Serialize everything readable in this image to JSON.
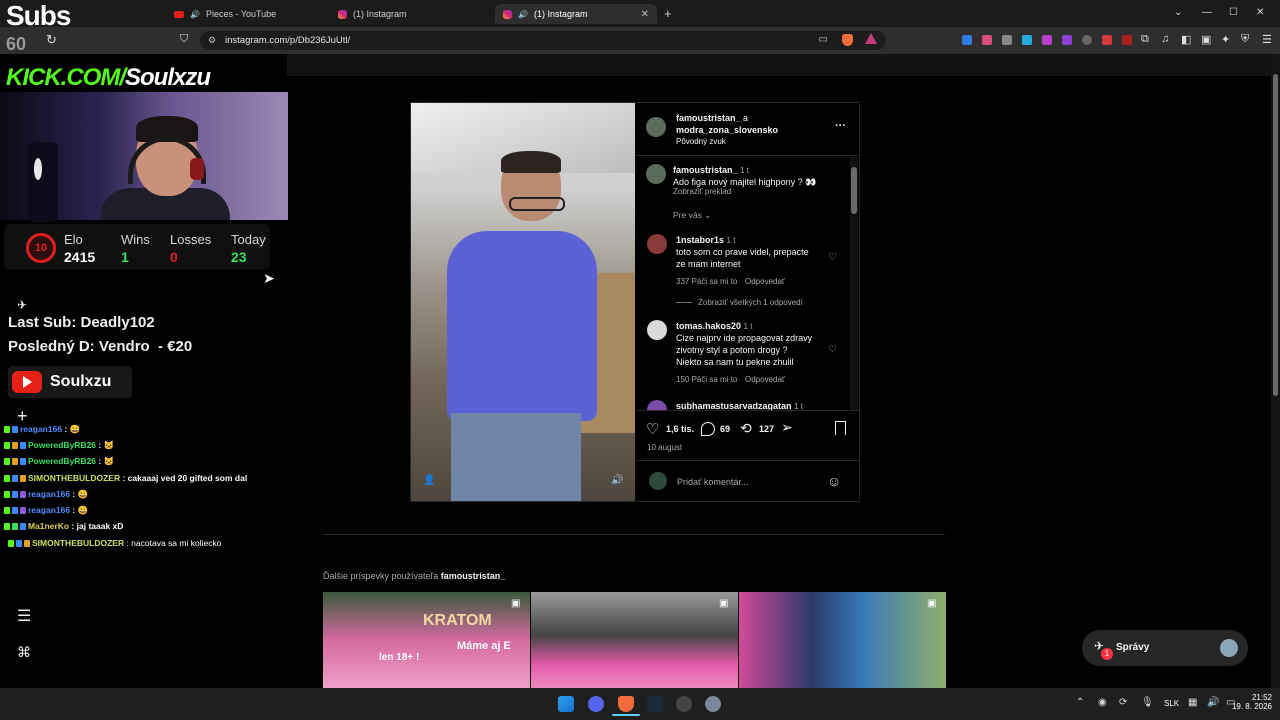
{
  "browser": {
    "tabs": [
      {
        "label": "Pieces - YouTube",
        "type": "youtube"
      },
      {
        "label": "(1) Instagram",
        "type": "instagram"
      },
      {
        "label": "(1) Instagram",
        "type": "instagram",
        "active": true
      }
    ],
    "new_tab": "+",
    "url": "instagram.com/p/Db236JuUtl/",
    "window_controls": [
      "⌄",
      "—",
      "☐",
      "✕"
    ]
  },
  "overlay": {
    "subs_label": "Subs",
    "subs_count": "60",
    "kick_prefix": "KICK.COM/",
    "kick_name": "Soulxzu",
    "stats": {
      "elo_label": "Elo",
      "elo_value": "2415",
      "level": "10",
      "wins_label": "Wins",
      "wins_value": "1",
      "losses_label": "Losses",
      "losses_value": "0",
      "today_label": "Today",
      "today_value": "23"
    },
    "last_sub": "Last Sub: Deadly102",
    "last_donation": "Posledný D: Vendro  - €20",
    "youtube_name": "Soulxzu",
    "chat": [
      {
        "user": "reagan166",
        "msg": " : 😀",
        "color": "#4f8dff"
      },
      {
        "user": "PoweredByRB26",
        "msg": " : 🐱",
        "color": "#38e060"
      },
      {
        "user": "PoweredByRB26",
        "msg": " : 🐱",
        "color": "#38e060"
      },
      {
        "user": "SIMONTHEBULDOZER",
        "msg": " : cakaaaj ved 20 gifted som dal",
        "color": "#c8e05a"
      },
      {
        "user": "reagan166",
        "msg": " : 😀",
        "color": "#4f8dff"
      },
      {
        "user": "reagan166",
        "msg": " : 😀",
        "color": "#4f8dff"
      },
      {
        "user": "Ma1nerKo",
        "msg": " : jaj taaak xD",
        "color": "#e0d04f"
      },
      {
        "user": "SIMONTHEBULDOZER",
        "msg": " : nacotava sa mi koliecko",
        "color": "#c8e05a"
      }
    ]
  },
  "post": {
    "author_line1": "famoustristan_",
    "author_and": " a",
    "author_line2": "modra_zona_slovensko",
    "audio": "Pôvodný zvuk",
    "more": "···",
    "caption": {
      "user": "famoustristan_",
      "time": "1 t",
      "text": "Ado figa nový majitel highpony ? 👀",
      "translate": "Zobraziť preklad"
    },
    "filter": "Pre vás",
    "comments": [
      {
        "user": "1nstabor1s",
        "time": "1 t",
        "lines": [
          "toto som co prave videl, prepacte",
          "ze mam internet"
        ],
        "likes": "337 Páči sa mi to",
        "reply": "Odpovedať"
      },
      {
        "user": "tomas.hakos20",
        "time": "1 t",
        "lines": [
          "Cize najprv ide propagovat zdravy",
          "zivotny styl a potom drogy ?",
          "Niekto sa nam tu pekne zhulil"
        ],
        "likes": "150 Páči sa mi to",
        "reply": "Odpovedať"
      },
      {
        "user": "subhamastusarvadzagatan",
        "time": "1 t",
        "lines": [],
        "likes": "",
        "reply": ""
      }
    ],
    "view_replies": "Zobraziť všetkých 1 odpovedí",
    "like_count": "1,6 tis.",
    "comment_count": "69",
    "repost_count": "127",
    "date": "10 august",
    "comment_placeholder": "Pridať komentár..."
  },
  "more_posts": {
    "prefix": "Ďalšie príspevky používateľa ",
    "user": "famoustristan_",
    "thumb1_text": "KRATOM",
    "thumb1_text2": "Máme aj E",
    "thumb1_text3": "len 18+ !"
  },
  "messages": {
    "label": "Správy",
    "badge": "1"
  },
  "taskbar": {
    "lang": "SLK",
    "time": "21:52",
    "date": "19. 8. 2026"
  }
}
